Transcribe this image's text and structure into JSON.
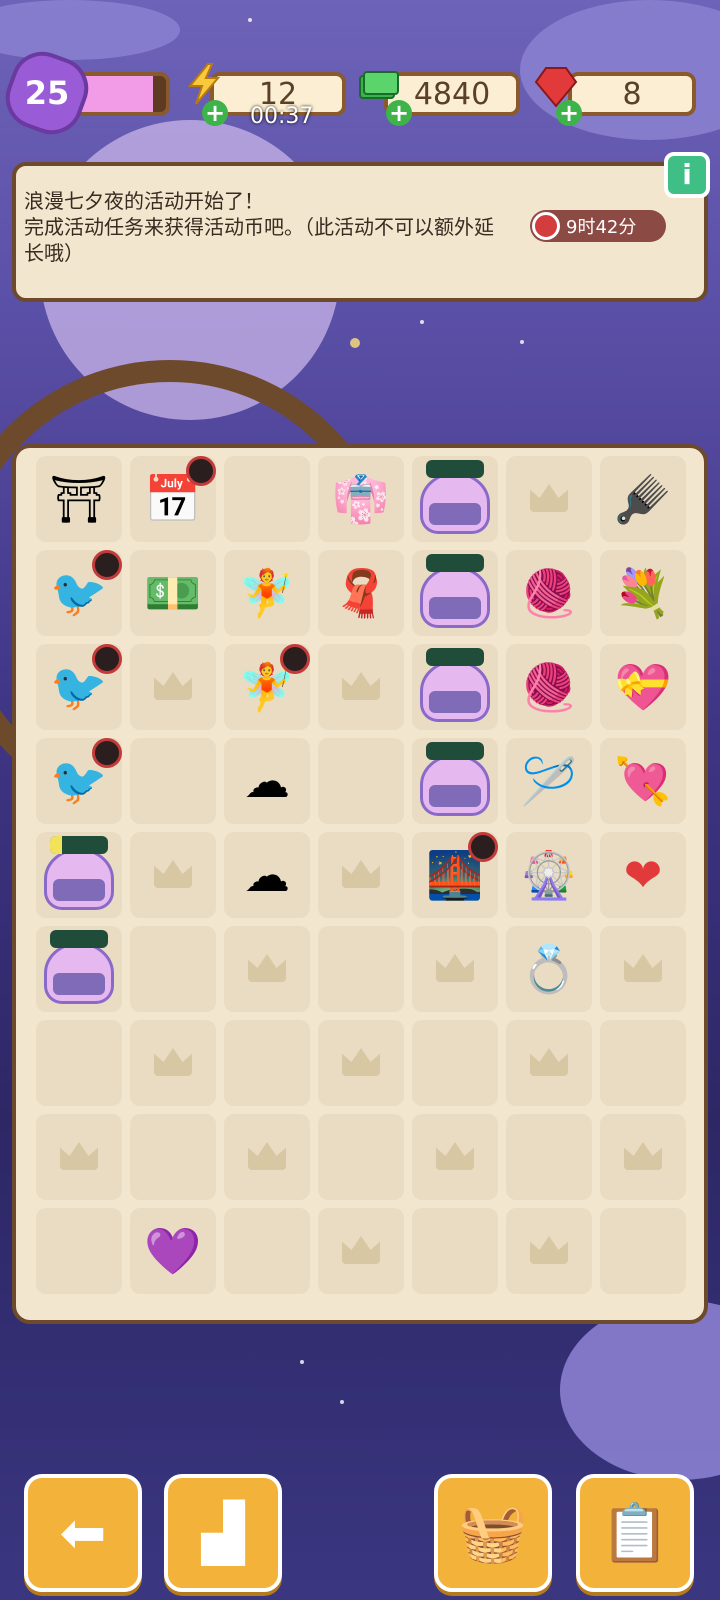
{
  "level": {
    "value": "25",
    "progress": 0.85
  },
  "energy": {
    "value": "12",
    "timer": "00:37"
  },
  "cash": {
    "value": "4840"
  },
  "gems": {
    "value": "8"
  },
  "event": {
    "message": "浪漫七夕夜的活动开始了！\n完成活动任务来获得活动币吧。（此活动不可以额外延长哦）",
    "countdown": "9时42分"
  },
  "info_icon": "info-icon",
  "colors": {
    "accent": "#f3b23a",
    "panel": "#f3e6cf",
    "border": "#6e4a2c",
    "background": "#3f3585"
  },
  "bottom_buttons": [
    "back-arrow-icon",
    "leaderboard-icon",
    "basket-icon",
    "task-clipboard-icon"
  ]
}
